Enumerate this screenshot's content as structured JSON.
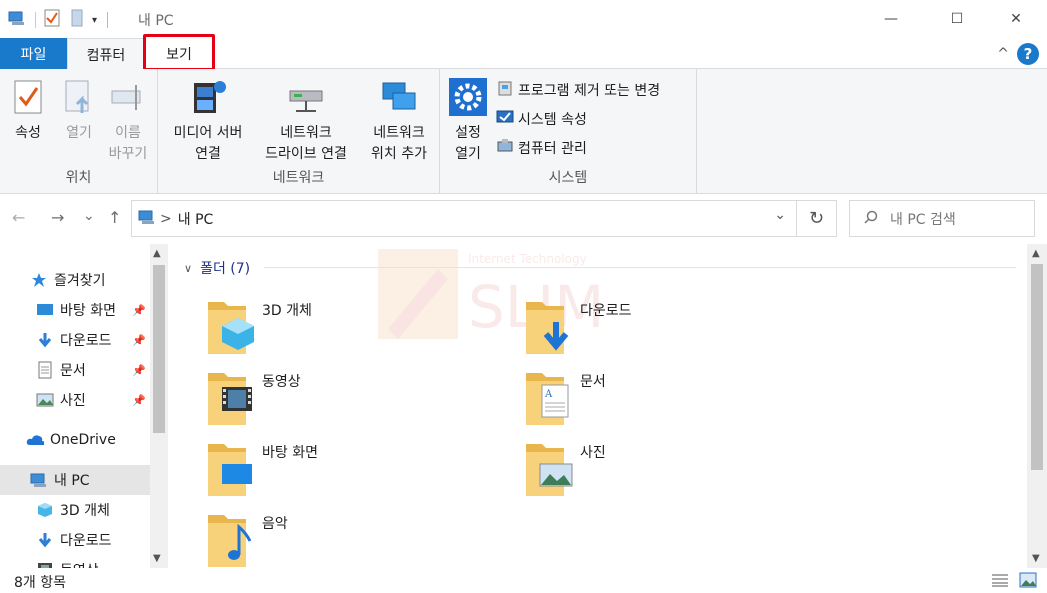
{
  "titlebar": {
    "title": "내 PC",
    "qa_dropdown": "▾",
    "minimize": "—",
    "maximize": "☐",
    "close": "✕"
  },
  "ribbon_tabs": {
    "file": "파일",
    "computer": "컴퓨터",
    "view": "보기",
    "collapse": "^",
    "help": "?"
  },
  "ribbon": {
    "location": {
      "label": "위치",
      "properties": "속성",
      "open": "열기",
      "rename_line1": "이름",
      "rename_line2": "바꾸기"
    },
    "network": {
      "label": "네트워크",
      "media_line1": "미디어 서버",
      "media_line2": "연결",
      "drive_line1": "네트워크",
      "drive_line2": "드라이브 연결",
      "loc_line1": "네트워크",
      "loc_line2": "위치 추가"
    },
    "system": {
      "label": "시스템",
      "settings_line1": "설정",
      "settings_line2": "열기",
      "uninstall": "프로그램 제거 또는 변경",
      "sysprops": "시스템 속성",
      "manage": "컴퓨터 관리"
    }
  },
  "nav": {
    "path_separator": ">",
    "path": "내 PC",
    "search_placeholder": "내 PC 검색",
    "back": "←",
    "forward": "→",
    "recent": "⌄",
    "up": "↑",
    "dropdown": "⌄",
    "refresh": "↻"
  },
  "sidebar": {
    "items": [
      {
        "label": "즐겨찾기"
      },
      {
        "label": "바탕 화면"
      },
      {
        "label": "다운로드"
      },
      {
        "label": "문서"
      },
      {
        "label": "사진"
      },
      {
        "label": "OneDrive"
      },
      {
        "label": "내 PC"
      },
      {
        "label": "3D 개체"
      },
      {
        "label": "다운로드"
      },
      {
        "label": "동영상"
      }
    ]
  },
  "content": {
    "section_title": "폴더 (7)",
    "folders": [
      {
        "label": "3D 개체"
      },
      {
        "label": "다운로드"
      },
      {
        "label": "동영상"
      },
      {
        "label": "문서"
      },
      {
        "label": "바탕 화면"
      },
      {
        "label": "사진"
      },
      {
        "label": "음악"
      }
    ]
  },
  "watermark": {
    "small": "Internet Technology",
    "big": "SLIM"
  },
  "status": {
    "item_count": "8개 항목"
  }
}
